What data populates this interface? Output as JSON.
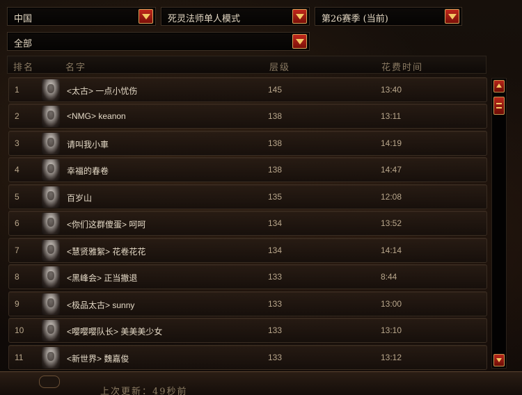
{
  "filters": {
    "region": "中国",
    "class_mode": "死灵法师单人模式",
    "season": "第26赛季 (当前)",
    "scope": "全部"
  },
  "columns": {
    "rank": "排名",
    "name": "名字",
    "level": "层级",
    "time": "花费时间"
  },
  "rows": [
    {
      "rank": "1",
      "name": "<太古> 一点小忧伤",
      "level": "145",
      "time": "13:40"
    },
    {
      "rank": "2",
      "name": "<NMG> keanon",
      "level": "138",
      "time": "13:11"
    },
    {
      "rank": "3",
      "name": "请叫我小車",
      "level": "138",
      "time": "14:19"
    },
    {
      "rank": "4",
      "name": "幸福的春卷",
      "level": "138",
      "time": "14:47"
    },
    {
      "rank": "5",
      "name": "百岁山",
      "level": "135",
      "time": "12:08"
    },
    {
      "rank": "6",
      "name": "<你们这群傻蛋> 呵呵",
      "level": "134",
      "time": "13:52"
    },
    {
      "rank": "7",
      "name": "<慧贤雅絮> 花卷花花",
      "level": "134",
      "time": "14:14"
    },
    {
      "rank": "8",
      "name": "<黑峰会> 正当撤退",
      "level": "133",
      "time": "8:44"
    },
    {
      "rank": "9",
      "name": "<极品太古> sunny",
      "level": "133",
      "time": "13:00"
    },
    {
      "rank": "10",
      "name": "<嘤嘤嘤队长> 美美美少女",
      "level": "133",
      "time": "13:10"
    },
    {
      "rank": "11",
      "name": "<新世界> 魏嘉俊",
      "level": "133",
      "time": "13:12"
    }
  ],
  "footer": {
    "last_update": "上次更新：49秒前"
  },
  "icons": {
    "dropdown": "chevron-down-icon",
    "scroll_up": "arrow-up-icon",
    "scroll_down": "arrow-down-icon",
    "avatar": "necromancer-portrait"
  },
  "colors": {
    "accent_red": "#b8261a",
    "accent_gold": "#f3c865",
    "text_primary": "#e4d9c6",
    "text_secondary": "#b9a78c"
  }
}
